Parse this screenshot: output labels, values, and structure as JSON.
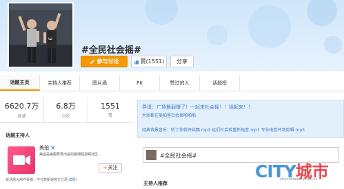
{
  "topic": {
    "title": "#全民社会摇#",
    "join_label": "参与讨论",
    "like_label": "赞(1551)",
    "share_label": "分享"
  },
  "tabs": [
    {
      "label": "话题主页"
    },
    {
      "label": "主持人推荐"
    },
    {
      "label": "图片墙"
    },
    {
      "label": "PK"
    },
    {
      "label": "赞过的人"
    },
    {
      "label": "话题榜"
    }
  ],
  "stats": [
    {
      "value": "6620.7万",
      "label": "阅读"
    },
    {
      "value": "6.8万",
      "label": "讨论"
    },
    {
      "value": "1551",
      "label": "赞"
    }
  ],
  "host": {
    "heading": "话题主持人",
    "name": "美拍",
    "verified": "V",
    "description": "美拍是美图秀秀出品的最潮短视频社区...",
    "follow_label": "关注",
    "footer_text": "该话题为用户投稿，不代表新浪官方立场",
    "footer_link": "详情»"
  },
  "guide": {
    "line1": "导语：广场舞弱爆了！一起来社会摇！！摇起来！！",
    "line2": "大家都在美拍里社会摇啪啪啪",
    "line3": "经典背景音乐：听了你就开始飘.mp3 这们社会摇重新电音.mp3 专业电音开场剪辑.mp3"
  },
  "composer": {
    "value": "#全民社会摇#"
  },
  "bottom_heading": "主持人推荐",
  "watermark": {
    "city": "CITY",
    "cn": "城市",
    "url": "city.chinadaily.com.cn"
  },
  "colors": {
    "accent": "#f39800",
    "link": "#3a7bc8",
    "banner": "#cfe6fb",
    "watermark_blue": "#4a97d8",
    "watermark_red": "#e8474c"
  }
}
